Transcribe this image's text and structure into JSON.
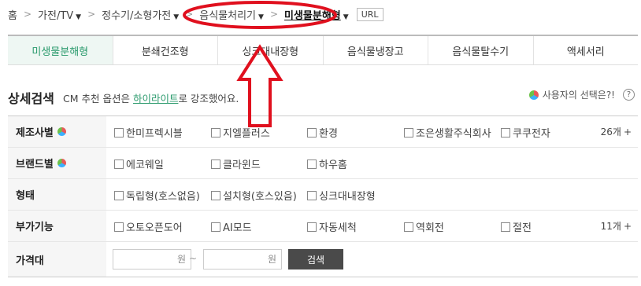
{
  "breadcrumb": {
    "home": "홈",
    "items": [
      "가전/TV",
      "정수기/소형가전",
      "음식물처리기"
    ],
    "current": "미생물분해형",
    "url_label": "URL"
  },
  "tabs": [
    "미생물분해형",
    "분쇄건조형",
    "싱크대내장형",
    "음식물냉장고",
    "음식물탈수기",
    "액세서리"
  ],
  "detail": {
    "title": "상세검색",
    "desc_prefix": "CM 추천 옵션은 ",
    "desc_highlight": "하이라이트",
    "desc_suffix": "로 강조했어요.",
    "user_choice": "사용자의 선택은?!",
    "help": "?"
  },
  "filters": {
    "maker": {
      "label": "제조사별",
      "options": [
        "한미프렉시블",
        "지엘플러스",
        "환경",
        "조은생활주식회사",
        "쿠쿠전자"
      ],
      "more": "26개",
      "more_sign": "+"
    },
    "brand": {
      "label": "브랜드별",
      "options": [
        "에코웨일",
        "클라윈드",
        "하우홈"
      ]
    },
    "type": {
      "label": "형태",
      "options": [
        "독립형(호스없음)",
        "설치형(호스있음)",
        "싱크대내장형"
      ]
    },
    "extra": {
      "label": "부가기능",
      "options": [
        "오토오픈도어",
        "AI모드",
        "자동세척",
        "역회전",
        "절전"
      ],
      "more": "11개",
      "more_sign": "+"
    },
    "price": {
      "label": "가격대",
      "unit": "원",
      "tilde": "~",
      "search": "검색"
    }
  },
  "colors": {
    "accent": "#2a9a6c",
    "annotation": "#e0101e"
  }
}
